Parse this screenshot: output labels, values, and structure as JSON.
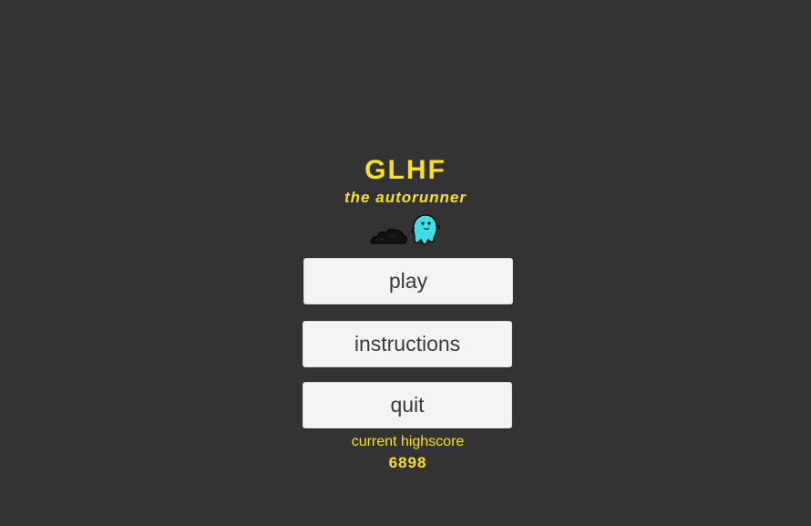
{
  "game": {
    "title": "GLHF",
    "subtitle": "the autorunner"
  },
  "mascot": {
    "icon": "ghost-character-icon",
    "cloud_icon": "dust-cloud-icon",
    "ghost_color": "#3ee0e8",
    "cloud_color": "#111111"
  },
  "menu": {
    "play_label": "play",
    "instructions_label": "instructions",
    "quit_label": "quit"
  },
  "highscore": {
    "label": "current highscore",
    "value": "6898"
  },
  "colors": {
    "background": "#333333",
    "accent": "#f7e21b",
    "button_bg": "#f4f4f4",
    "button_text": "#3a3a3a"
  }
}
